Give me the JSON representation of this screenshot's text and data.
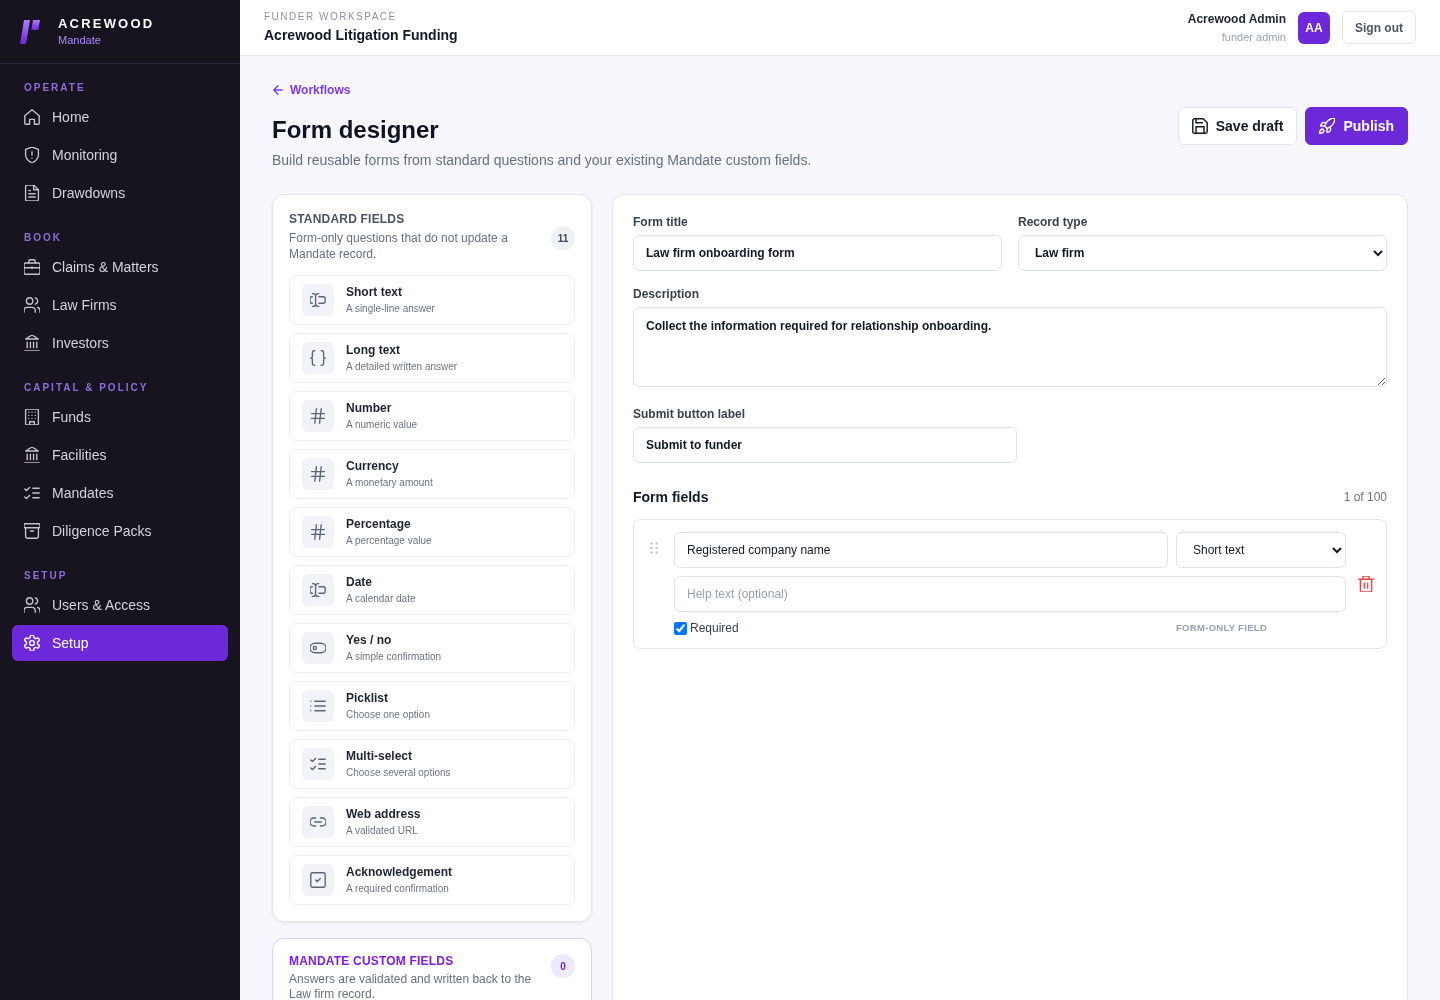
{
  "sidebar": {
    "brand": {
      "name": "ACREWOOD",
      "product": "Mandate"
    },
    "sections": [
      {
        "label": "OPERATE",
        "items": [
          {
            "label": "Home",
            "selected": false
          },
          {
            "label": "Monitoring",
            "selected": false
          },
          {
            "label": "Drawdowns",
            "selected": false
          }
        ]
      },
      {
        "label": "BOOK",
        "items": [
          {
            "label": "Claims & Matters",
            "selected": false
          },
          {
            "label": "Law Firms",
            "selected": false
          },
          {
            "label": "Investors",
            "selected": false
          }
        ]
      },
      {
        "label": "CAPITAL & POLICY",
        "items": [
          {
            "label": "Funds",
            "selected": false
          },
          {
            "label": "Facilities",
            "selected": false
          },
          {
            "label": "Mandates",
            "selected": false
          },
          {
            "label": "Diligence Packs",
            "selected": false
          }
        ]
      },
      {
        "label": "SETUP",
        "items": [
          {
            "label": "Users & Access",
            "selected": false
          },
          {
            "label": "Setup",
            "selected": true
          }
        ]
      }
    ]
  },
  "header": {
    "workspace_label": "FUNDER WORKSPACE",
    "workspace_name": "Acrewood Litigation Funding",
    "user": {
      "name": "Acrewood Admin",
      "role": "funder admin",
      "initials": "AA"
    },
    "sign_out": "Sign out"
  },
  "page": {
    "back_link": "Workflows",
    "title": "Form designer",
    "subtitle": "Build reusable forms from standard questions and your existing Mandate custom fields.",
    "actions": [
      {
        "label": "Save draft",
        "kind": "secondary"
      },
      {
        "label": "Publish",
        "kind": "primary"
      }
    ]
  },
  "standard_fields": {
    "title": "STANDARD FIELDS",
    "description": "Form-only questions that do not update a Mandate record.",
    "count": "11",
    "items": [
      {
        "name": "Short text",
        "description": "A single-line answer"
      },
      {
        "name": "Long text",
        "description": "A detailed written answer"
      },
      {
        "name": "Number",
        "description": "A numeric value"
      },
      {
        "name": "Currency",
        "description": "A monetary amount"
      },
      {
        "name": "Percentage",
        "description": "A percentage value"
      },
      {
        "name": "Date",
        "description": "A calendar date"
      },
      {
        "name": "Yes / no",
        "description": "A simple confirmation"
      },
      {
        "name": "Picklist",
        "description": "Choose one option"
      },
      {
        "name": "Multi-select",
        "description": "Choose several options"
      },
      {
        "name": "Web address",
        "description": "A validated URL"
      },
      {
        "name": "Acknowledgement",
        "description": "A required confirmation"
      }
    ]
  },
  "custom_fields": {
    "title": "MANDATE CUSTOM FIELDS",
    "description": "Answers are validated and written back to the Law firm record.",
    "count": "0"
  },
  "form": {
    "form_title": {
      "label": "Form title",
      "value": "Law firm onboarding form"
    },
    "record_type": {
      "label": "Record type",
      "value": "Law firm"
    },
    "description": {
      "label": "Description",
      "value": "Collect the information required for relationship onboarding."
    },
    "submit_label": {
      "label": "Submit button label",
      "value": "Submit to funder"
    },
    "fields_section": {
      "title": "Form fields",
      "count": "1 of 100",
      "fields": [
        {
          "name": "Registered company name",
          "type": "Short text",
          "help_text": {
            "placeholder": "Help text (optional)"
          },
          "required": true,
          "required_label": "Required",
          "scope": "FORM-ONLY FIELD"
        }
      ]
    }
  }
}
